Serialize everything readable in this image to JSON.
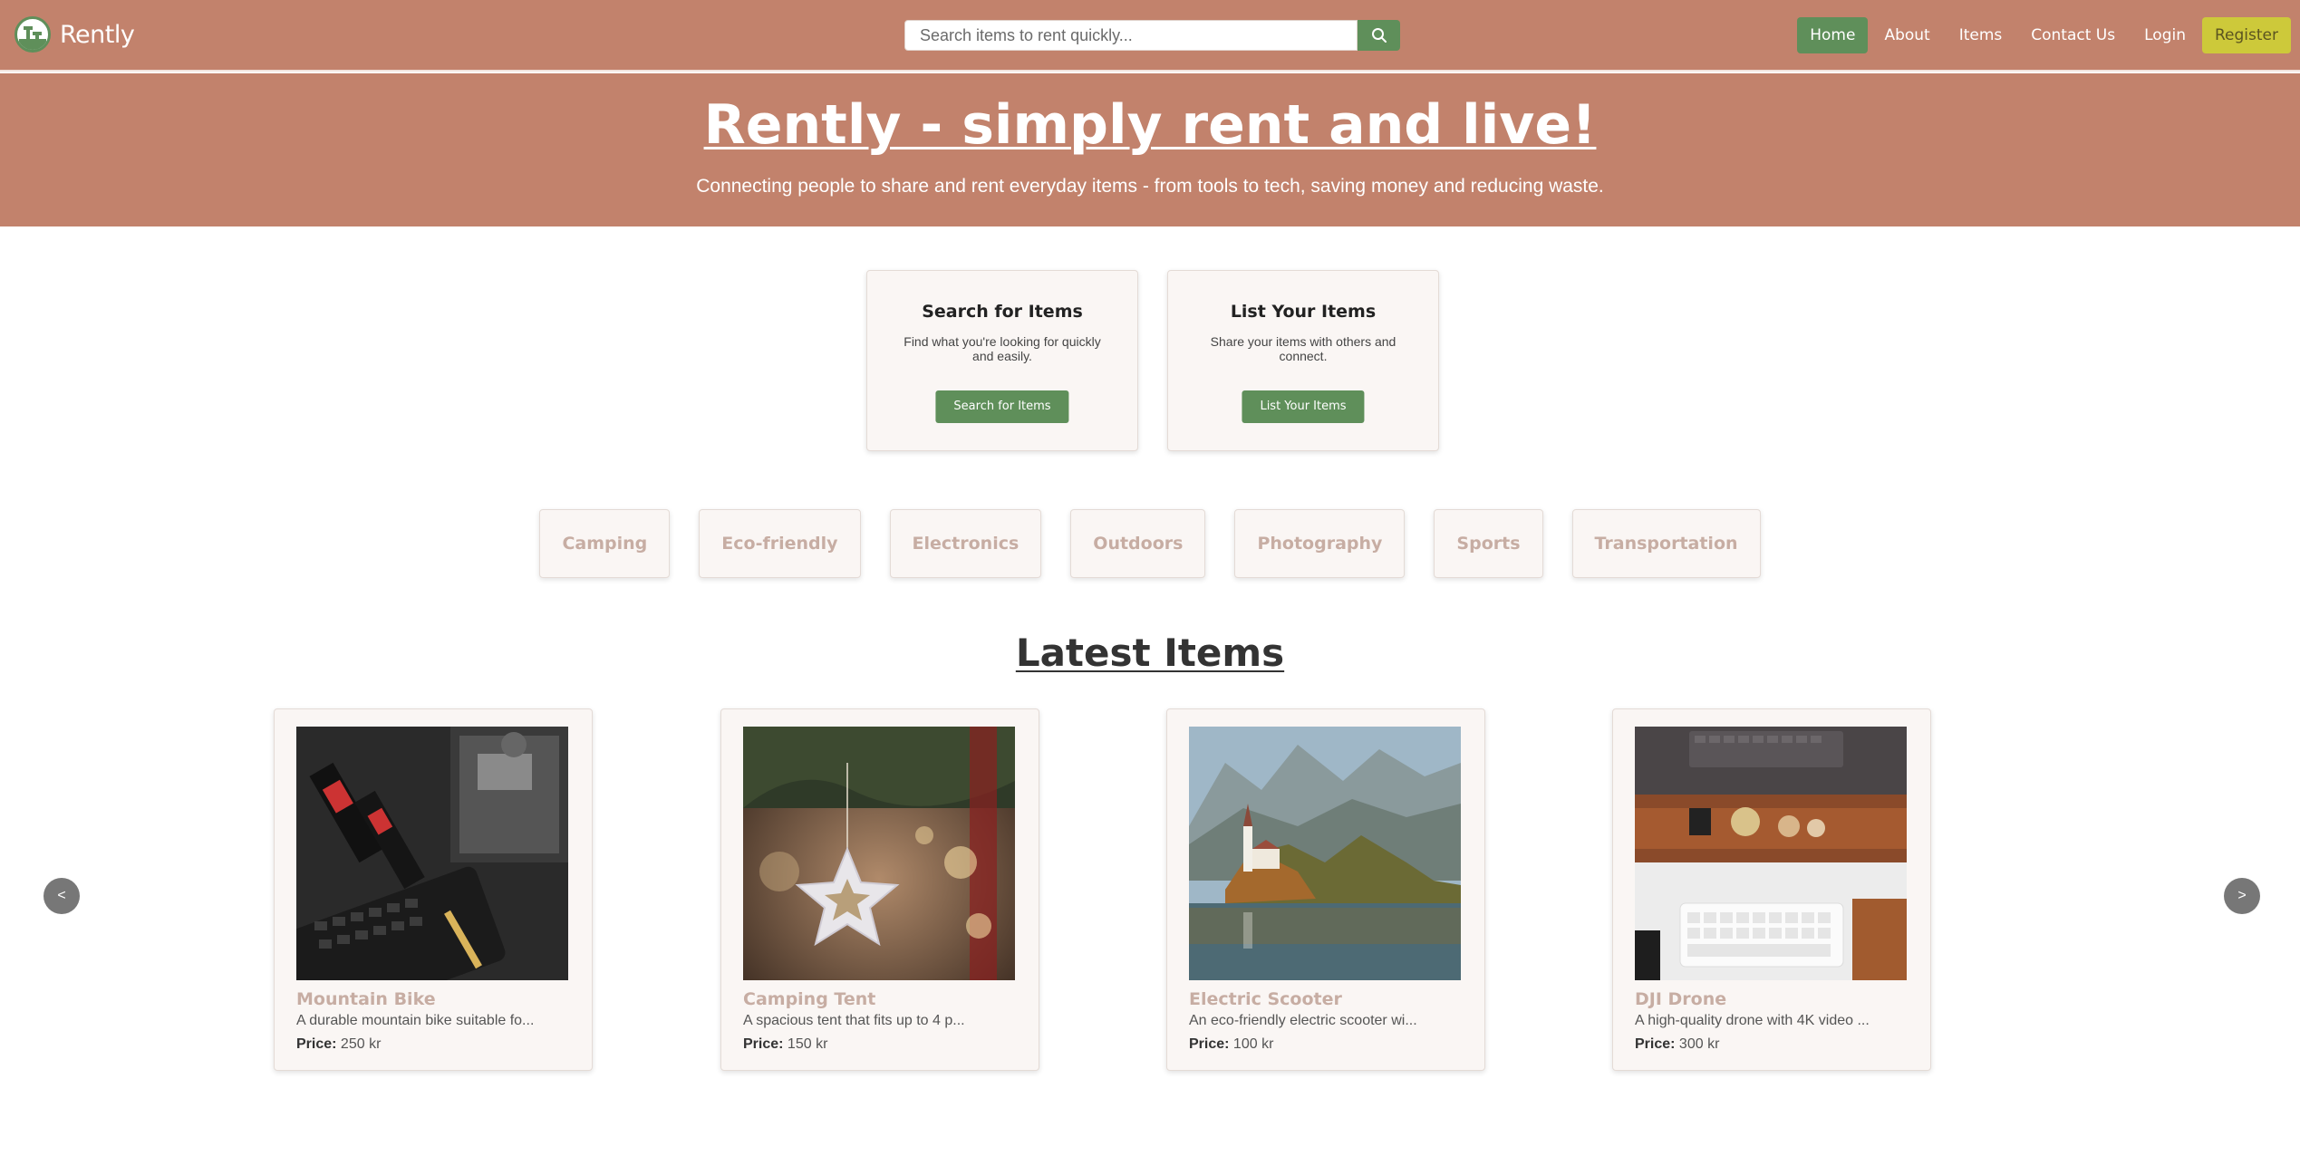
{
  "brand": {
    "name": "Rently"
  },
  "search": {
    "placeholder": "Search items to rent quickly..."
  },
  "nav": {
    "items": [
      {
        "label": "Home"
      },
      {
        "label": "About"
      },
      {
        "label": "Items"
      },
      {
        "label": "Contact Us"
      },
      {
        "label": "Login"
      },
      {
        "label": "Register"
      }
    ],
    "active": "Home"
  },
  "hero": {
    "title": "Rently - simply rent and live!",
    "subtitle": "Connecting people to share and rent everyday items - from tools to tech, saving money and reducing waste."
  },
  "actions": [
    {
      "title": "Search for Items",
      "text": "Find what you're looking for quickly and easily.",
      "button": "Search for Items"
    },
    {
      "title": "List Your Items",
      "text": "Share your items with others and connect.",
      "button": "List Your Items"
    }
  ],
  "categories": [
    "Camping",
    "Eco-friendly",
    "Electronics",
    "Outdoors",
    "Photography",
    "Sports",
    "Transportation"
  ],
  "latest": {
    "title": "Latest Items",
    "price_label": "Price:",
    "items": [
      {
        "name": "Mountain Bike",
        "desc": "A durable mountain bike suitable fo...",
        "price": "250 kr",
        "image": "laptop-parts-photo"
      },
      {
        "name": "Camping Tent",
        "desc": "A spacious tent that fits up to 4 p...",
        "price": "150 kr",
        "image": "star-ornament-photo"
      },
      {
        "name": "Electric Scooter",
        "desc": "An eco-friendly electric scooter wi...",
        "price": "100 kr",
        "image": "lake-church-photo"
      },
      {
        "name": "DJI Drone",
        "desc": "A high-quality drone with 4K video ...",
        "price": "300 kr",
        "image": "desk-keyboard-photo"
      }
    ]
  },
  "carousel": {
    "prev": "<",
    "next": ">"
  },
  "colors": {
    "primary": "#c2826c",
    "accent_green": "#5f8f5a",
    "register_yellow": "#cdc93a",
    "card_bg": "#faf6f4",
    "muted_label": "#c7ada3"
  }
}
